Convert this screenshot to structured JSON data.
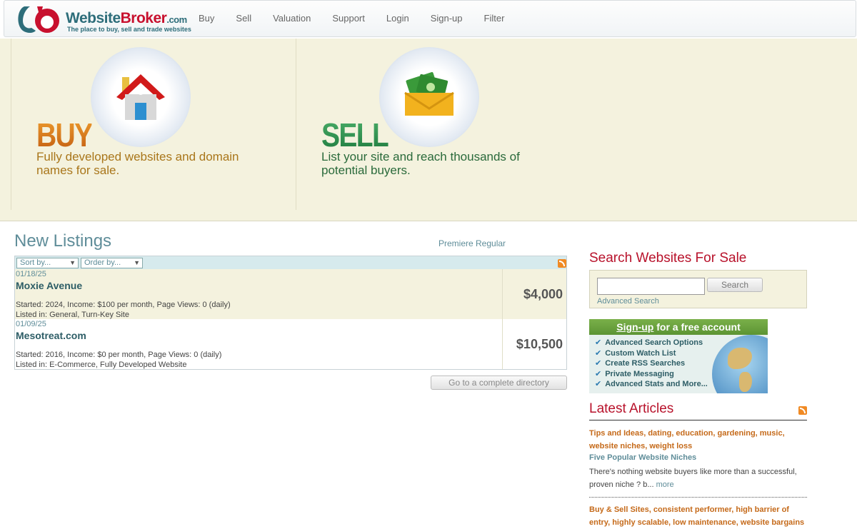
{
  "header": {
    "logo_name_main": "Website",
    "logo_name_accent": "Broker",
    "logo_domain": ".com",
    "logo_tagline": "The place to buy, sell and trade websites",
    "nav": [
      "Buy",
      "Sell",
      "Valuation",
      "Support",
      "Login",
      "Sign-up",
      "Filter"
    ]
  },
  "hero": {
    "buy": {
      "title": "BUY",
      "desc": "Fully developed websites and domain names for sale."
    },
    "sell": {
      "title": "SELL",
      "desc": "List your site and reach thousands of potential buyers."
    }
  },
  "listings": {
    "title": "New Listings",
    "tabs": "Premiere Regular",
    "sort_label": "Sort by...",
    "order_label": "Order by...",
    "rows": [
      {
        "date": "01/18/25",
        "name": "Moxie Avenue",
        "meta1": "Started: 2024, Income: $100 per month, Page Views: 0 (daily)",
        "meta2": "Listed in: General, Turn-Key Site",
        "price": "$4,000"
      },
      {
        "date": "01/09/25",
        "name": "Mesotreat.com",
        "meta1": "Started: 2016, Income: $0 per month, Page Views: 0 (daily)",
        "meta2": "Listed in: E-Commerce, Fully Developed Website",
        "price": "$10,500"
      }
    ],
    "directory_button": "Go to a complete directory"
  },
  "sidebar": {
    "search_title": "Search Websites For Sale",
    "search_button": "Search",
    "search_value": "",
    "advanced_link": "Advanced Search",
    "signup_link": "Sign-up",
    "signup_rest": " for a free account",
    "signup_features": [
      "Advanced Search Options",
      "Custom Watch List",
      "Create RSS Searches",
      "Private Messaging",
      "Advanced Stats and More..."
    ],
    "articles_title": "Latest Articles",
    "articles": [
      {
        "tags": "Tips and Ideas, dating, education, gardening, music, website niches, weight loss",
        "title": "Five Popular Website Niches",
        "excerpt": "There's nothing website buyers like more than a successful, proven niche ? b...",
        "more": " more"
      },
      {
        "tags": "Buy & Sell Sites, consistent performer, high barrier of entry, highly scalable, low maintenance, website bargains"
      }
    ]
  },
  "colors": {
    "brand_teal": "#2d6d7a",
    "brand_red": "#c8102e",
    "hero_bg": "#f4f2de",
    "accent_orange": "#c56a1a"
  }
}
